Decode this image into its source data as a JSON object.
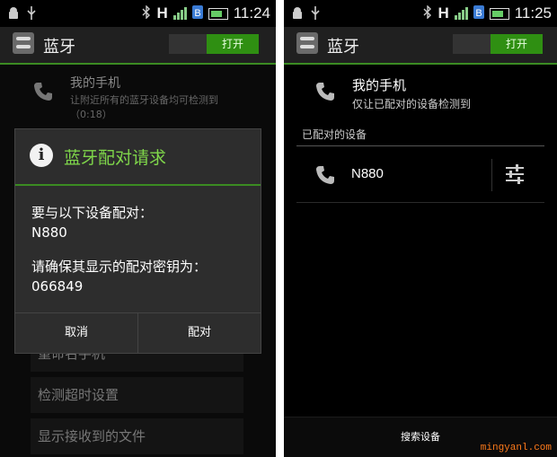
{
  "left": {
    "status_bar": {
      "hd": "H",
      "time": "11:24"
    },
    "app_title": "蓝牙",
    "toggle_label": "打开",
    "my_phone": {
      "title": "我的手机",
      "subtitle": "让附近所有的蓝牙设备均可检测到（0:18）"
    },
    "list_items": [
      "重命名手机",
      "检测超时设置",
      "显示接收到的文件"
    ],
    "dialog": {
      "title": "蓝牙配对请求",
      "line1": "要与以下设备配对：",
      "device": "N880",
      "line2": "请确保其显示的配对密钥为：",
      "passkey": "066849",
      "cancel": "取消",
      "pair": "配对"
    }
  },
  "right": {
    "status_bar": {
      "hd": "H",
      "time": "11:25"
    },
    "app_title": "蓝牙",
    "toggle_label": "打开",
    "my_phone": {
      "title": "我的手机",
      "subtitle": "仅让已配对的设备检测到"
    },
    "section_header": "已配对的设备",
    "paired_device": "N880",
    "scan_button": "搜索设备"
  },
  "watermark": "mingyanl.com",
  "icons": [
    "android-icon",
    "usb-icon",
    "bluetooth-icon",
    "signal-icon",
    "battery-icon",
    "phone-icon",
    "settings-sliders-icon",
    "info-icon"
  ],
  "colors": {
    "accent": "#3b8b22",
    "toggle": "#2f8f12",
    "title_green": "#7fd64a",
    "watermark": "#ff7a1a"
  }
}
